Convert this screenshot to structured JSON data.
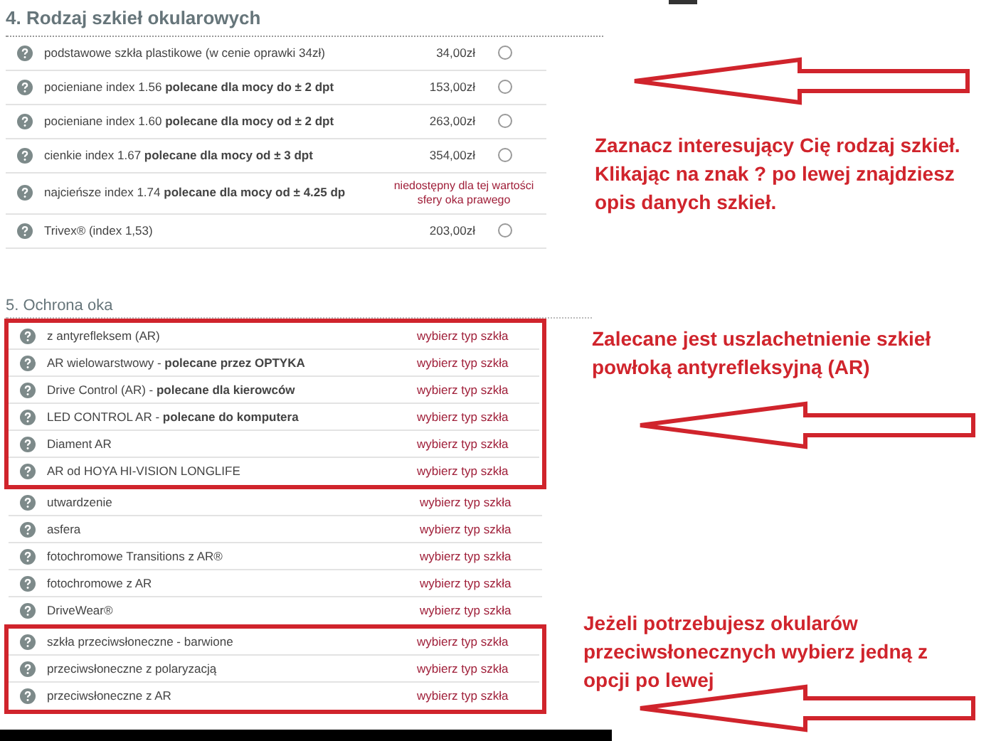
{
  "lens_section": {
    "title": "4. Rodzaj szkieł okularowych",
    "rows": [
      {
        "kind": "price",
        "name": "podstawowe szkła plastikowe (w cenie oprawki 34zł)",
        "price": "34,00zł",
        "selected": false
      },
      {
        "kind": "price",
        "name": "pocieniane index 1.56 **polecane dla mocy do ± 2 dpt**",
        "price": "153,00zł",
        "selected": false
      },
      {
        "kind": "price",
        "name": "pocieniane index 1.60 **polecane dla mocy od ± 2 dpt**",
        "price": "263,00zł",
        "selected": false
      },
      {
        "kind": "price",
        "name": "cienkie index 1.67 **polecane dla mocy od ± 3 dpt**",
        "price": "354,00zł",
        "selected": false
      },
      {
        "kind": "unavailable",
        "name": "najcieńsze index 1.74 **polecane dla mocy od ± 4.25 dp**",
        "note": "niedostępny dla tej wartości sfery oka prawego"
      },
      {
        "kind": "price",
        "name": "Trivex® (index 1,53)",
        "price": "203,00zł",
        "selected": false
      }
    ]
  },
  "protection_section": {
    "title": "5. Ochrona oka",
    "groups": [
      {
        "highlighted": true,
        "rows": [
          {
            "name": "z antyrefleksem (AR)",
            "status": "wybierz typ szkła"
          },
          {
            "name": "AR wielowarstwowy - **polecane przez OPTYKA**",
            "status": "wybierz typ szkła"
          },
          {
            "name": "Drive Control (AR) - **polecane dla kierowców**",
            "status": "wybierz typ szkła"
          },
          {
            "name": "LED CONTROL AR - **polecane do komputera**",
            "status": "wybierz typ szkła"
          },
          {
            "name": "Diament AR",
            "status": "wybierz typ szkła"
          },
          {
            "name": "AR od HOYA HI-VISION LONGLIFE",
            "status": "wybierz typ szkła"
          }
        ]
      },
      {
        "highlighted": false,
        "rows": [
          {
            "name": "utwardzenie",
            "status": "wybierz typ szkła"
          },
          {
            "name": "asfera",
            "status": "wybierz typ szkła"
          },
          {
            "name": "fotochromowe Transitions z AR®",
            "status": "wybierz typ szkła"
          },
          {
            "name": "fotochromowe z AR",
            "status": "wybierz typ szkła"
          },
          {
            "name": "DriveWear®",
            "status": "wybierz typ szkła"
          }
        ]
      },
      {
        "highlighted": true,
        "rows": [
          {
            "name": "szkła przeciwsłoneczne - barwione",
            "status": "wybierz typ szkła"
          },
          {
            "name": "przeciwsłoneczne z polaryzacją",
            "status": "wybierz typ szkła"
          },
          {
            "name": "przeciwsłoneczne z AR",
            "status": "wybierz typ szkła"
          }
        ]
      }
    ]
  },
  "annotations": [
    {
      "text": "Zaznacz interesujący Cię rodzaj szkieł. Klikając na znak ? po lewej znajdziesz opis danych szkieł."
    },
    {
      "text": "Zalecane jest uszlachetnienie szkieł powłoką antyrefleksyjną (AR)"
    },
    {
      "text": "Jeżeli potrzebujesz okularów przeciwsłonecznych wybierz jedną z opcji po lewej"
    }
  ]
}
